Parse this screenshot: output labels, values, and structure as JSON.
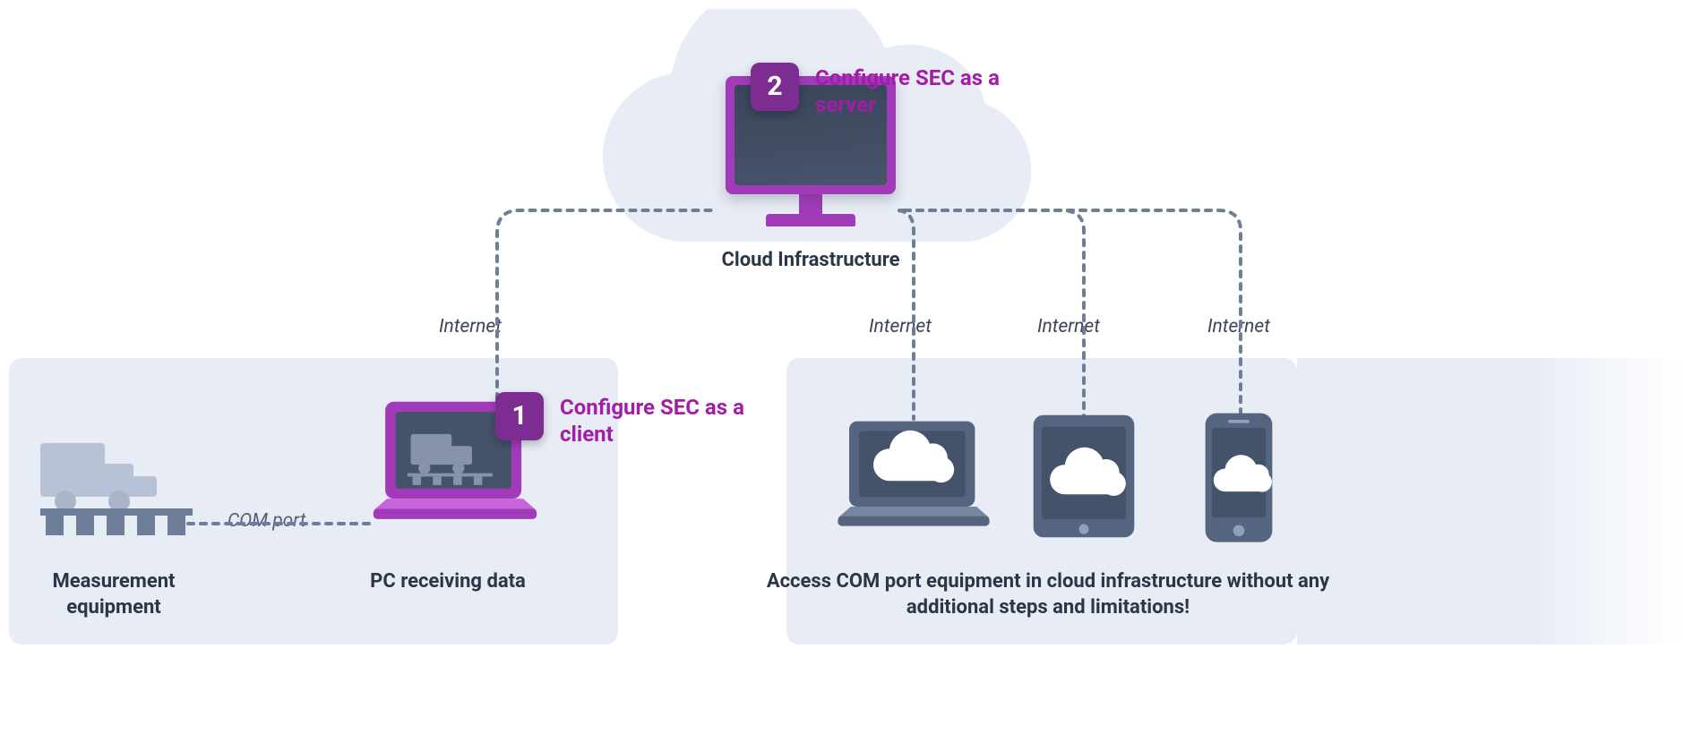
{
  "cloud": {
    "label": "Cloud Infrastructure"
  },
  "steps": {
    "s1": {
      "num": "1",
      "text": "Configure SEC as a client"
    },
    "s2": {
      "num": "2",
      "text": "Configure SEC as a server"
    }
  },
  "left_panel": {
    "equipment_label": "Measurement equipment",
    "pc_label": "PC receiving data",
    "com_label": "COM port"
  },
  "right_panel": {
    "access_label": "Access COM port equipment in cloud infrastructure without any additional steps and limitations!"
  },
  "links": {
    "internet": "Internet"
  },
  "colors": {
    "accent": "#a21ea9",
    "badge": "#7d2c92",
    "text": "#2b3649",
    "panel": "#e7ecf5",
    "slate": "#55607a",
    "device_dark": "#44536a"
  }
}
